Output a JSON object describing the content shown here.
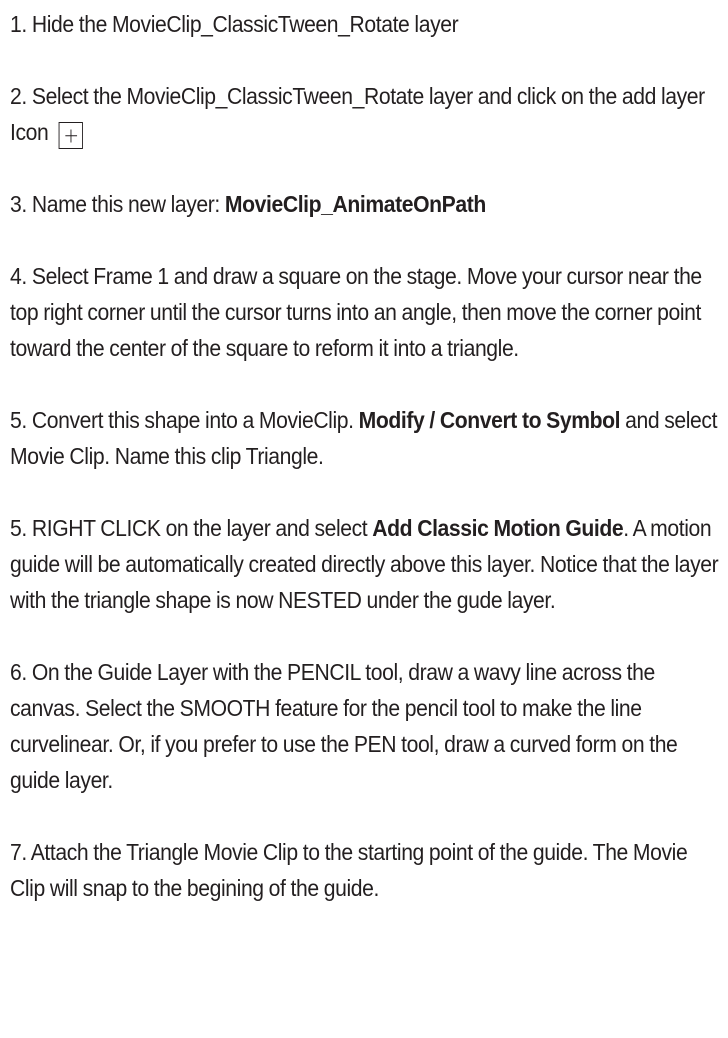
{
  "steps": [
    {
      "number": "1.",
      "text": "Hide the MovieClip_ClassicTween_Rotate layer"
    },
    {
      "number": "2.",
      "text": "Select the MovieClip_ClassicTween_Rotate layer and click on the add layer Icon",
      "icon": "add-layer-plus-icon"
    },
    {
      "number": "3.",
      "text_before": "Name this new layer: ",
      "bold": "MovieClip_AnimateOnPath"
    },
    {
      "number": "4.",
      "text": "Select Frame 1 and draw a square on the stage. Move your cursor near the top right corner until the cursor turns into an angle, then move the corner point toward the center of the square to reform it into a triangle."
    },
    {
      "number": "5.",
      "text_before": "Convert this shape into a MovieClip. ",
      "bold": "Modify / Convert to Symbol",
      "text_after": " and select Movie Clip. Name this clip Triangle."
    },
    {
      "number": "5.",
      "text_before": "RIGHT CLICK on the layer and select ",
      "bold": "Add Classic Motion Guide",
      "text_after": ". A motion guide will be automatically created directly above this layer. Notice that the layer with the triangle shape is now NESTED under the gude layer."
    },
    {
      "number": "6.",
      "text": "On the Guide Layer with the PENCIL tool, draw a wavy line across the canvas. Select the SMOOTH feature for the pencil tool to make the line curvelinear. Or, if you prefer to use the PEN tool, draw a curved form on the guide layer."
    },
    {
      "number": "7.",
      "text": "Attach the Triangle Movie Clip  to the starting point of the guide. The Movie Clip will snap to the begining of the guide."
    }
  ]
}
